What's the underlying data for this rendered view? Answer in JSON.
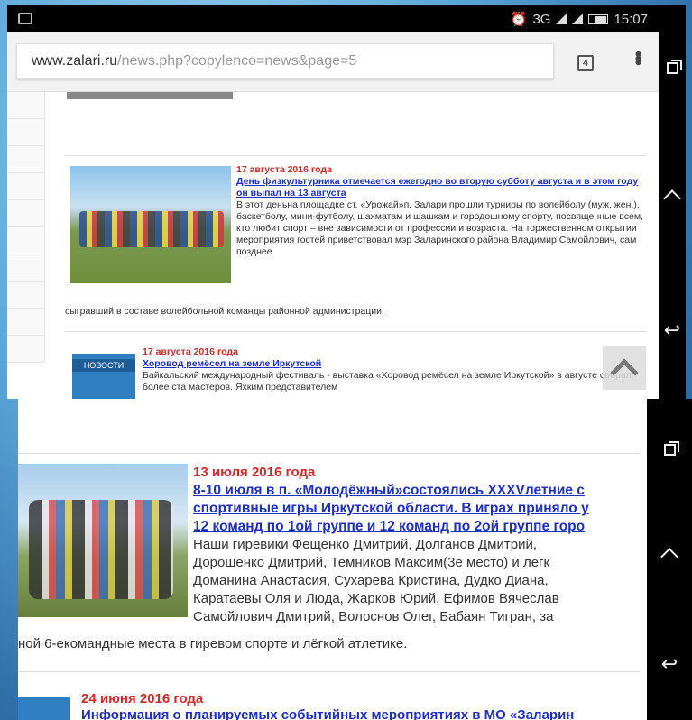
{
  "status_bar": {
    "time": "15:07",
    "network": "3G"
  },
  "browser": {
    "url_host": "www.zalari.ru",
    "url_path": "/news.php?copylenco=news&page=5",
    "tab_count": "4"
  },
  "news": [
    {
      "date": "17 августа 2016 года",
      "title": "День физкультурника отмечается ежегодно во вторую субботу августа и в этом году он выпал на 13 августа",
      "text": "В этот деньна площадке ст. «Урожай»п. Залари прошли турниры по волейболу (муж, жен.), баскетболу, мини-футболу, шахматам и шашкам и городошному спорту, посвященные всем, кто любит спорт – вне зависимости от профессии и возраста. На торжественном открытии мероприятия гостей приветствовал мэр Заларинского района Владимир Самойлович, сам позднее",
      "text_tail": "сыгравший в составе волейбольной команды районной администрации."
    },
    {
      "date": "17 августа 2016 года",
      "title": "Хоровод ремёсел на земле Иркутской",
      "text": "Байкальский международный фестиваль - выставка «Хоровод ремёсел на земле Иркутской» в августе собрал более ста мастеров. Яхким представителем",
      "thumb_label": "НОВОСТИ"
    },
    {
      "date": "13 июля 2016 года",
      "title_lines": [
        "8-10 июля в п. «Молодёжный»состоялись XXXVлетние с",
        "спортивные игры Иркутской области. В играх приняло у",
        "12 команд по 1ой группе и 12 команд по 2ой группе горо"
      ],
      "text_lines": [
        "Наши гиревики Фещенко Дмитрий, Долганов Дмитрий,",
        "Дорошенко Дмитрий, Темников Максим(3е место) и легк",
        "Доманина Анастасия, Сухарева Кристина, Дудко Диана,",
        "Каратаевы Оля и Люда, Жарков Юрий, Ефимов Вячеслав",
        "Самойлович Дмитрий, Волоснов Олег, Бабаян Тигран, за"
      ],
      "text_tail": "ной 6-екомандные места в гиревом спорте и лёгкой атлетике."
    },
    {
      "date": "24 июня 2016 года",
      "title": "Информация о планируемых событийных мероприятиях в МО «Заларин"
    }
  ]
}
